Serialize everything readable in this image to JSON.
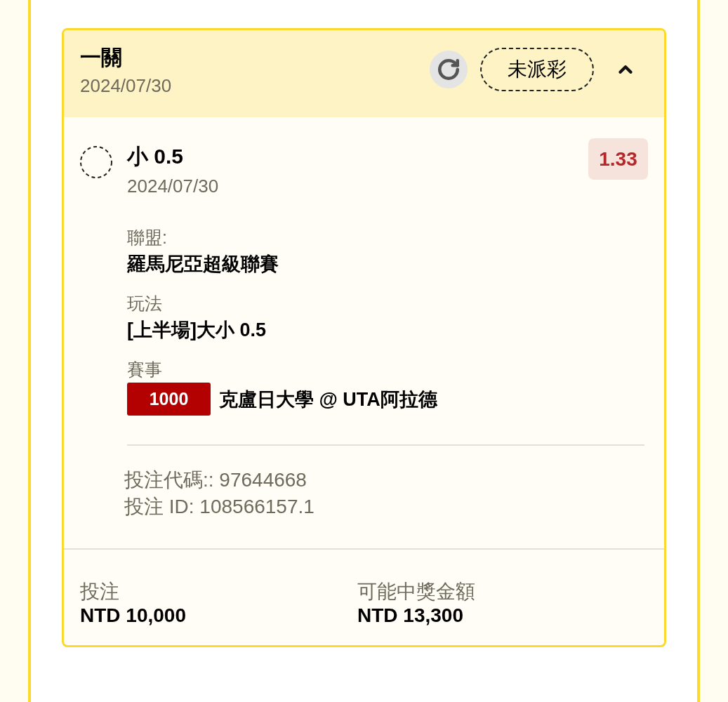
{
  "slip": {
    "title": "一關",
    "date": "2024/07/30",
    "status": "未派彩",
    "expanded": true
  },
  "selection": {
    "name": "小 0.5",
    "date": "2024/07/30",
    "odds": "1.33"
  },
  "details": [
    {
      "kind": "text",
      "label": "聯盟:",
      "value": "羅馬尼亞超級聯賽"
    },
    {
      "kind": "text",
      "label": "玩法",
      "value": "[上半場]大小 0.5"
    },
    {
      "kind": "event",
      "label": "賽事",
      "tag": "1000",
      "value": "克盧日大學 @ UTA阿拉德"
    }
  ],
  "codes": [
    "投注代碼:: 97644668",
    "投注 ID: 108566157.1"
  ],
  "totals": [
    {
      "label": "投注",
      "value": "NTD 10,000"
    },
    {
      "label": "可能中獎金額",
      "value": "NTD 13,300"
    }
  ]
}
